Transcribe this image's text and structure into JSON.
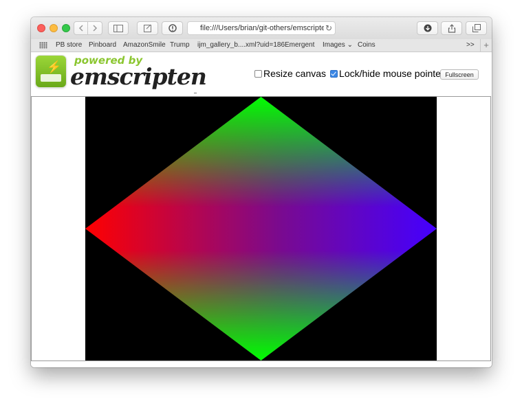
{
  "browser": {
    "url": "file:///Users/brian/git-others/emscripte",
    "bookmarks": [
      "PB store",
      "Pinboard",
      "AmazonSmile",
      "Trump",
      "ijm_gallery_b....xml?uid=186",
      "Emergent",
      "Images ⌄",
      "Coins"
    ],
    "overflow": ">>",
    "new_tab": "+"
  },
  "header": {
    "powered_by": "powered by",
    "brand": "emscripten"
  },
  "controls": {
    "resize_canvas": {
      "label": "Resize canvas",
      "checked": false
    },
    "lock_pointer": {
      "label": "Lock/hide mouse pointer",
      "checked": true
    },
    "fullscreen_label": "Fullscreen"
  },
  "canvas": {
    "background": "#000000",
    "vertex_colors": {
      "top": "#00ff00",
      "left": "#ff0000",
      "right": "#4400ff",
      "bottom": "#00ff00"
    }
  },
  "colors": {
    "brand_green": "#8bc630",
    "accent_blue": "#3b87e5"
  }
}
